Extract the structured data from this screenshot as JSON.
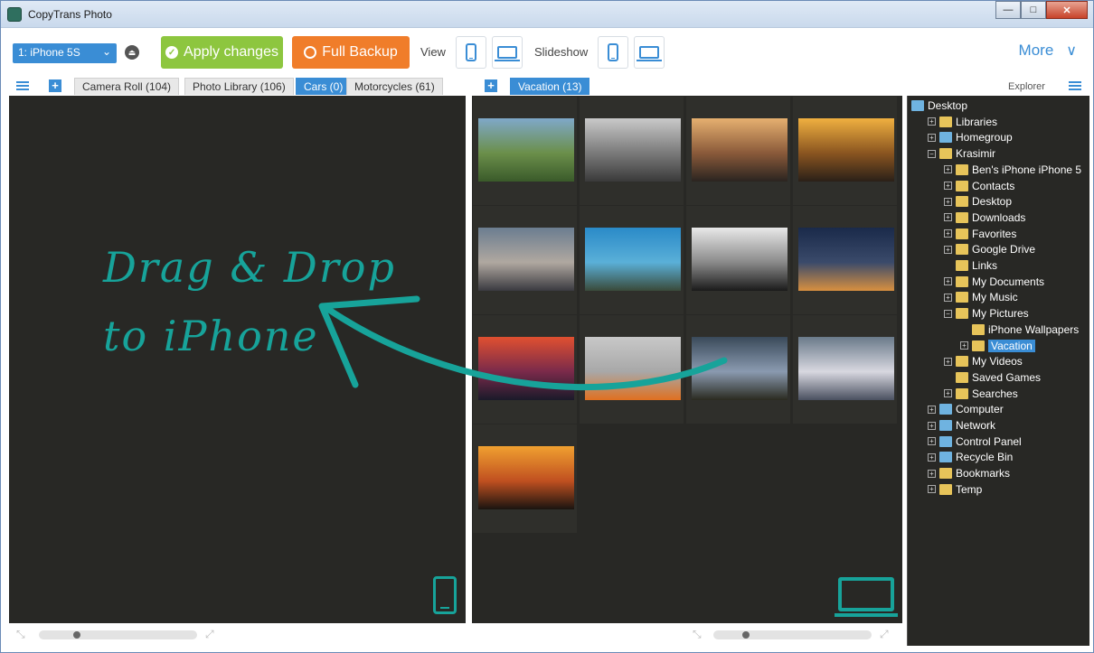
{
  "window": {
    "title": "CopyTrans Photo",
    "min": "—",
    "max": "□",
    "close": "✕"
  },
  "toolbar": {
    "device": "1: iPhone 5S",
    "apply_label": "Apply changes",
    "backup_label": "Full Backup",
    "view_label": "View",
    "slideshow_label": "Slideshow",
    "more_label": "More"
  },
  "tabs_left": [
    {
      "label": "Camera Roll (104)",
      "active": false
    },
    {
      "label": "Photo Library (106)",
      "active": false
    },
    {
      "label": "Cars (0)",
      "active": true
    },
    {
      "label": "Motorcycles (61)",
      "active": false
    }
  ],
  "tabs_mid": [
    {
      "label": "Vacation (13)",
      "active": true
    }
  ],
  "explorer": {
    "label": "Explorer",
    "tree": [
      {
        "label": "Desktop",
        "level": 0,
        "expander": "",
        "icon": "desktop-icon"
      },
      {
        "label": "Libraries",
        "level": 1,
        "expander": "+",
        "icon": "folder-icon"
      },
      {
        "label": "Homegroup",
        "level": 1,
        "expander": "+",
        "icon": "homegroup-icon"
      },
      {
        "label": "Krasimir",
        "level": 1,
        "expander": "−",
        "icon": "user-folder-icon"
      },
      {
        "label": "Ben's iPhone iPhone 5",
        "level": 2,
        "expander": "+",
        "icon": "folder-icon"
      },
      {
        "label": "Contacts",
        "level": 2,
        "expander": "+",
        "icon": "folder-icon"
      },
      {
        "label": "Desktop",
        "level": 2,
        "expander": "+",
        "icon": "folder-icon"
      },
      {
        "label": "Downloads",
        "level": 2,
        "expander": "+",
        "icon": "folder-icon"
      },
      {
        "label": "Favorites",
        "level": 2,
        "expander": "+",
        "icon": "folder-icon"
      },
      {
        "label": "Google Drive",
        "level": 2,
        "expander": "+",
        "icon": "folder-icon"
      },
      {
        "label": "Links",
        "level": 2,
        "expander": "",
        "icon": "folder-icon"
      },
      {
        "label": "My Documents",
        "level": 2,
        "expander": "+",
        "icon": "folder-icon"
      },
      {
        "label": "My Music",
        "level": 2,
        "expander": "+",
        "icon": "folder-icon"
      },
      {
        "label": "My Pictures",
        "level": 2,
        "expander": "−",
        "icon": "folder-icon"
      },
      {
        "label": "iPhone Wallpapers",
        "level": 3,
        "expander": "",
        "icon": "folder-icon"
      },
      {
        "label": "Vacation",
        "level": 3,
        "expander": "+",
        "icon": "folder-icon",
        "selected": true
      },
      {
        "label": "My Videos",
        "level": 2,
        "expander": "+",
        "icon": "folder-icon"
      },
      {
        "label": "Saved Games",
        "level": 2,
        "expander": "",
        "icon": "folder-icon"
      },
      {
        "label": "Searches",
        "level": 2,
        "expander": "+",
        "icon": "folder-icon"
      },
      {
        "label": "Computer",
        "level": 1,
        "expander": "+",
        "icon": "computer-icon"
      },
      {
        "label": "Network",
        "level": 1,
        "expander": "+",
        "icon": "network-icon"
      },
      {
        "label": "Control Panel",
        "level": 1,
        "expander": "+",
        "icon": "control-panel-icon"
      },
      {
        "label": "Recycle Bin",
        "level": 1,
        "expander": "+",
        "icon": "recycle-bin-icon"
      },
      {
        "label": "Bookmarks",
        "level": 1,
        "expander": "+",
        "icon": "folder-icon"
      },
      {
        "label": "Temp",
        "level": 1,
        "expander": "+",
        "icon": "folder-icon"
      }
    ]
  },
  "drag_drop": {
    "line1": "Drag & Drop",
    "line2": "to iPhone"
  },
  "photos": [
    {
      "colors": [
        "#7fa8c9",
        "#6b8f4a",
        "#3a5a2a"
      ]
    },
    {
      "colors": [
        "#c9c9c9",
        "#7a7a7a",
        "#3a3a3a"
      ]
    },
    {
      "colors": [
        "#e6b070",
        "#8a5a3a",
        "#2a2420"
      ]
    },
    {
      "colors": [
        "#f0b040",
        "#8a5520",
        "#2a2018"
      ]
    },
    {
      "colors": [
        "#6b7d90",
        "#b0a8a0",
        "#3a3a40"
      ]
    },
    {
      "colors": [
        "#2a8ac8",
        "#5ab0d8",
        "#3a4a3a"
      ]
    },
    {
      "colors": [
        "#e8e8e8",
        "#8a8a8a",
        "#1a1a1a"
      ]
    },
    {
      "colors": [
        "#1a2a4a",
        "#3a4a6a",
        "#d89040"
      ]
    },
    {
      "colors": [
        "#e05030",
        "#7a2a4a",
        "#1a1a2a"
      ]
    },
    {
      "colors": [
        "#c8c8c8",
        "#a8a8a8",
        "#e07020"
      ]
    },
    {
      "colors": [
        "#3a4a5a",
        "#8a9ab0",
        "#2a2a20"
      ]
    },
    {
      "colors": [
        "#6a7a8a",
        "#d8d8e0",
        "#4a5060"
      ]
    },
    {
      "colors": [
        "#f0a030",
        "#c05020",
        "#1a1410"
      ]
    }
  ]
}
